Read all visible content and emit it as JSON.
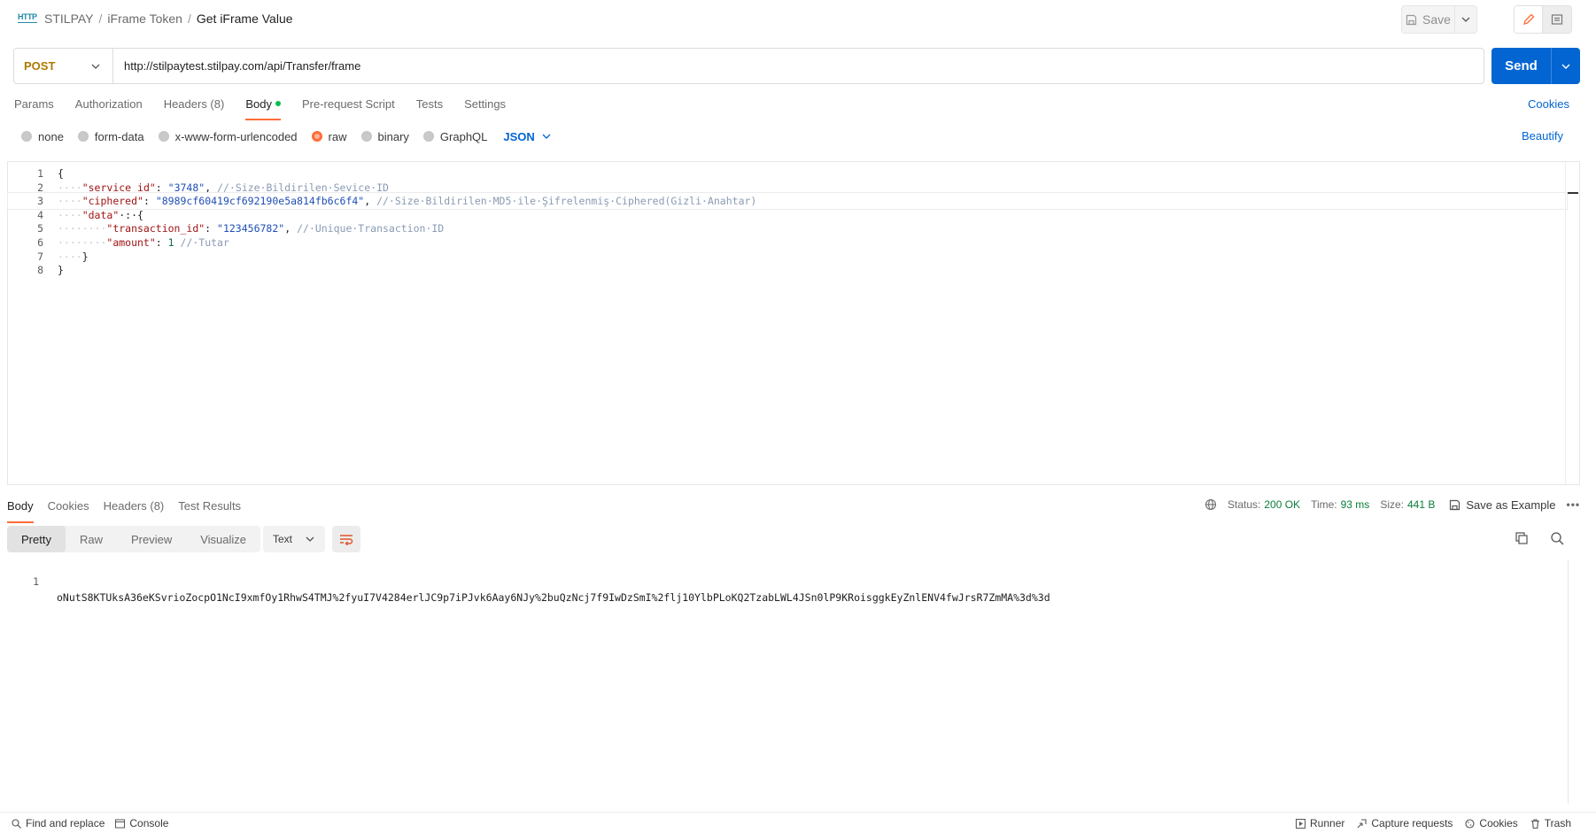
{
  "header": {
    "icon_label": "HTTP",
    "breadcrumb": [
      "STILPAY",
      "iFrame Token",
      "Get iFrame Value"
    ],
    "save_label": "Save"
  },
  "request": {
    "method": "POST",
    "url": "http://stilpaytest.stilpay.com/api/Transfer/frame",
    "send_label": "Send"
  },
  "request_tabs": [
    {
      "label": "Params"
    },
    {
      "label": "Authorization"
    },
    {
      "label": "Headers (8)"
    },
    {
      "label": "Body"
    },
    {
      "label": "Pre-request Script"
    },
    {
      "label": "Tests"
    },
    {
      "label": "Settings"
    }
  ],
  "active_request_tab": "Body",
  "cookies_label": "Cookies",
  "body_types": [
    {
      "label": "none",
      "selected": false
    },
    {
      "label": "form-data",
      "selected": false
    },
    {
      "label": "x-www-form-urlencoded",
      "selected": false
    },
    {
      "label": "raw",
      "selected": true
    },
    {
      "label": "binary",
      "selected": false
    },
    {
      "label": "GraphQL",
      "selected": false
    }
  ],
  "raw_language": "JSON",
  "beautify_label": "Beautify",
  "editor": {
    "lines": [
      {
        "n": "1",
        "parts": [
          [
            "p",
            "{"
          ]
        ]
      },
      {
        "n": "2",
        "parts": [
          [
            "d",
            "····"
          ],
          [
            "k",
            "\"service_id\""
          ],
          [
            "p",
            ": "
          ],
          [
            "s",
            "\"3748\""
          ],
          [
            "p",
            ", "
          ],
          [
            "c",
            "//·Size·Bildirilen·Sevice·ID"
          ]
        ]
      },
      {
        "n": "3",
        "parts": [
          [
            "d",
            "····"
          ],
          [
            "k",
            "\"ciphered\""
          ],
          [
            "p",
            ": "
          ],
          [
            "s",
            "\"8989cf60419cf692190e5a814fb6c6f4\""
          ],
          [
            "p",
            ", "
          ],
          [
            "c",
            "//·Size·Bildirilen·MD5·ile·Şifrelenmiş·Ciphered(Gizli·Anahtar)"
          ]
        ]
      },
      {
        "n": "4",
        "parts": [
          [
            "d",
            "····"
          ],
          [
            "k",
            "\"data\""
          ],
          [
            "p",
            "·:·{"
          ]
        ]
      },
      {
        "n": "5",
        "parts": [
          [
            "d",
            "········"
          ],
          [
            "k",
            "\"transaction_id\""
          ],
          [
            "p",
            ": "
          ],
          [
            "s",
            "\"123456782\""
          ],
          [
            "p",
            ", "
          ],
          [
            "c",
            "//·Unique·Transaction·ID"
          ]
        ]
      },
      {
        "n": "6",
        "parts": [
          [
            "d",
            "········"
          ],
          [
            "k",
            "\"amount\""
          ],
          [
            "p",
            ": "
          ],
          [
            "m",
            "1"
          ],
          [
            "p",
            " "
          ],
          [
            "c",
            "//·Tutar"
          ]
        ]
      },
      {
        "n": "7",
        "parts": [
          [
            "d",
            "····"
          ],
          [
            "p",
            "}"
          ]
        ]
      },
      {
        "n": "8",
        "parts": [
          [
            "p",
            "}"
          ]
        ]
      }
    ]
  },
  "response": {
    "tabs": [
      {
        "label": "Body"
      },
      {
        "label": "Cookies"
      },
      {
        "label": "Headers (8)"
      },
      {
        "label": "Test Results"
      }
    ],
    "active_tab": "Body",
    "status_label": "Status:",
    "status_value": "200 OK",
    "time_label": "Time:",
    "time_value": "93 ms",
    "size_label": "Size:",
    "size_value": "441 B",
    "save_example_label": "Save as Example",
    "more_label": "•••",
    "views": [
      {
        "label": "Pretty"
      },
      {
        "label": "Raw"
      },
      {
        "label": "Preview"
      },
      {
        "label": "Visualize"
      }
    ],
    "active_view": "Pretty",
    "format": "Text",
    "body_line_number": "1",
    "body_text": "oNutS8KTUksA36eKSvrioZocpO1NcI9xmfOy1RhwS4TMJ%2fyuI7V4284erlJC9p7iPJvk6Aay6NJy%2buQzNcj7f9IwDzSmI%2flj10YlbPLoKQ2TzabLWL4JSn0lP9KRoisggkEyZnlENV4fwJrsR7ZmMA%3d%3d"
  },
  "statusbar": {
    "left": [
      {
        "label": "Find and replace",
        "icon": "search-icon"
      },
      {
        "label": "Console",
        "icon": "console-icon"
      }
    ],
    "right": [
      {
        "label": "Runner",
        "icon": "runner-icon"
      },
      {
        "label": "Capture requests",
        "icon": "capture-icon"
      },
      {
        "label": "Cookies",
        "icon": "cookie-icon"
      },
      {
        "label": "Trash",
        "icon": "trash-icon"
      }
    ]
  },
  "colors": {
    "accent": "#ff6c37",
    "send": "#0265d2",
    "method": "#ad7a03",
    "status_ok": "#0a7d3a"
  }
}
